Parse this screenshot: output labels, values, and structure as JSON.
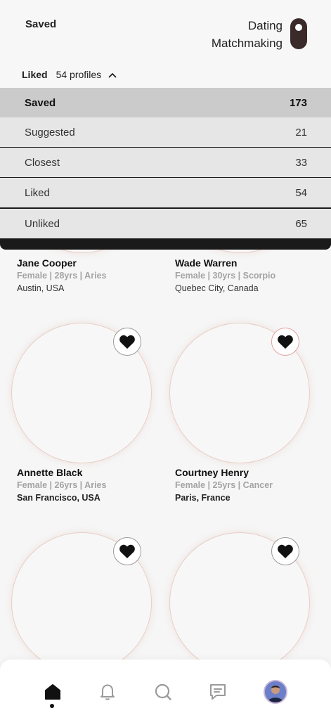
{
  "header": {
    "title": "Saved",
    "mode_line1": "Dating",
    "mode_line2": "Matchmaking"
  },
  "filter": {
    "current": "Liked",
    "count_text": "54 profiles"
  },
  "dropdown": {
    "items": [
      {
        "label": "Saved",
        "count": "173"
      },
      {
        "label": "Suggested",
        "count": "21"
      },
      {
        "label": "Closest",
        "count": "33"
      },
      {
        "label": "Liked",
        "count": "54"
      },
      {
        "label": "Unliked",
        "count": "65"
      }
    ]
  },
  "profiles": [
    {
      "name": "Jane Cooper",
      "meta": "Female | 28yrs | Aries",
      "location": "Austin, USA"
    },
    {
      "name": "Wade Warren",
      "meta": "Female | 30yrs | Scorpio",
      "location": "Quebec City, Canada"
    },
    {
      "name": "Annette Black",
      "meta": "Female | 26yrs | Aries",
      "location": "San Francisco, USA"
    },
    {
      "name": "Courtney Henry",
      "meta": "Female | 25yrs | Cancer",
      "location": "Paris, France"
    }
  ],
  "colors": {
    "accent": "#3b2a2a",
    "dropdown_active": "#cbcbcb",
    "dropdown_item": "#e6e6e6",
    "photo_ring": "#e8cfc6"
  },
  "icons": {
    "filter": "chevron-up-icon",
    "like": "heart-icon",
    "nav": [
      "home-icon",
      "bell-icon",
      "search-icon",
      "chat-icon",
      "profile-avatar"
    ]
  }
}
